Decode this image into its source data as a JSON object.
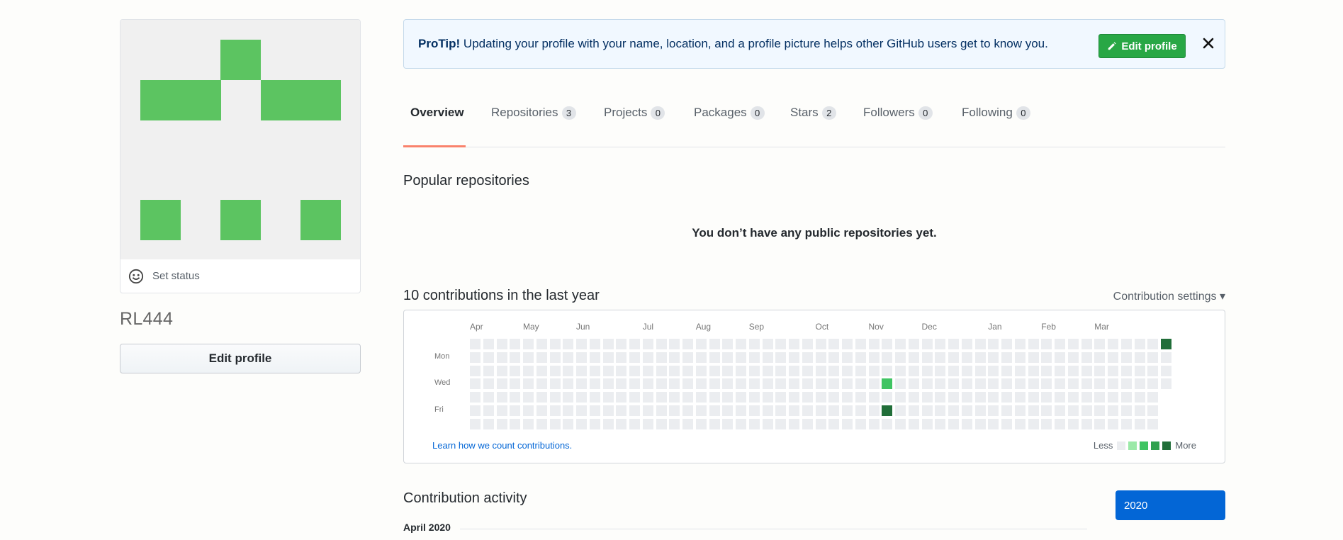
{
  "profile": {
    "username": "RL444",
    "status_label": "Set status",
    "edit_button": "Edit profile",
    "avatar_color": "#5cc461"
  },
  "protip": {
    "label": "ProTip!",
    "text": " Updating your profile with your name, location, and a profile picture helps other GitHub users get to know you.",
    "button": "Edit profile",
    "close_icon": "close-icon"
  },
  "tabs": [
    {
      "label": "Overview",
      "count": null,
      "active": true
    },
    {
      "label": "Repositories",
      "count": "3"
    },
    {
      "label": "Projects",
      "count": "0"
    },
    {
      "label": "Packages",
      "count": "0"
    },
    {
      "label": "Stars",
      "count": "2"
    },
    {
      "label": "Followers",
      "count": "0"
    },
    {
      "label": "Following",
      "count": "0"
    }
  ],
  "popular": {
    "title": "Popular repositories",
    "empty": "You don’t have any public repositories yet."
  },
  "contributions": {
    "title": "10 contributions in the last year",
    "settings": "Contribution settings ▾",
    "months": [
      "Apr",
      "May",
      "Jun",
      "Jul",
      "Aug",
      "Sep",
      "Oct",
      "Nov",
      "Dec",
      "Jan",
      "Feb",
      "Mar"
    ],
    "days": [
      "Mon",
      "Wed",
      "Fri"
    ],
    "learn_link": "Learn how we count contributions.",
    "legend_less": "Less",
    "legend_more": "More",
    "colors": [
      "#ebedf0",
      "#9be9a8",
      "#40c463",
      "#30a14e",
      "#216e39"
    ],
    "active_cells": [
      {
        "week": 52,
        "day": 0,
        "level": 4
      },
      {
        "week": 31,
        "day": 3,
        "level": 2
      },
      {
        "week": 31,
        "day": 5,
        "level": 4
      }
    ]
  },
  "activity": {
    "title": "Contribution activity",
    "year": "2020",
    "month_heading": "April 2020"
  }
}
